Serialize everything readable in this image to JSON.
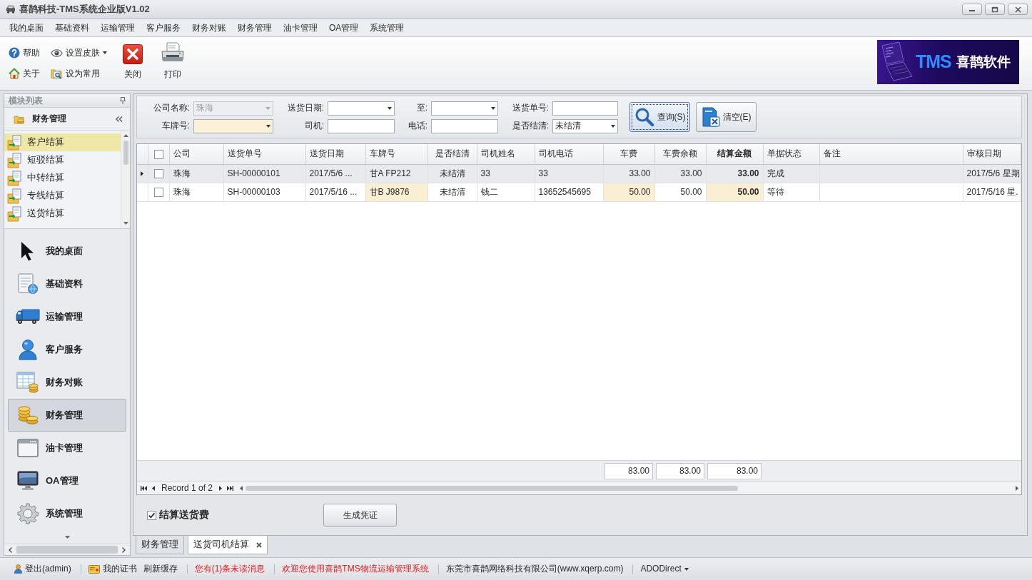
{
  "window": {
    "title": "喜鹊科技-TMS系统企业版V1.02"
  },
  "menu": [
    "我的桌面",
    "基础资料",
    "运输管理",
    "客户服务",
    "财务对账",
    "财务管理",
    "油卡管理",
    "OA管理",
    "系统管理"
  ],
  "toolbar": {
    "small_items": [
      {
        "label": "帮助",
        "dropdown": false
      },
      {
        "label": "设置皮肤",
        "dropdown": true
      },
      {
        "label": "关于",
        "dropdown": false
      },
      {
        "label": "设为常用",
        "dropdown": false
      }
    ],
    "large_items": [
      {
        "label": "关闭"
      },
      {
        "label": "打印"
      }
    ]
  },
  "logo": {
    "brand": "TMS",
    "name": "喜鹊软件"
  },
  "sidebar": {
    "title": "模块列表",
    "group": "财务管理",
    "items": [
      {
        "label": "客户结算",
        "selected": true
      },
      {
        "label": "短驳结算",
        "selected": false
      },
      {
        "label": "中转结算",
        "selected": false
      },
      {
        "label": "专线结算",
        "selected": false
      },
      {
        "label": "送货结算",
        "selected": false
      }
    ],
    "nav": [
      {
        "label": "我的桌面",
        "selected": false
      },
      {
        "label": "基础资料",
        "selected": false
      },
      {
        "label": "运输管理",
        "selected": false
      },
      {
        "label": "客户服务",
        "selected": false
      },
      {
        "label": "财务对账",
        "selected": false
      },
      {
        "label": "财务管理",
        "selected": true
      },
      {
        "label": "油卡管理",
        "selected": false
      },
      {
        "label": "OA管理",
        "selected": false
      },
      {
        "label": "系统管理",
        "selected": false
      }
    ]
  },
  "filters": [
    {
      "label": "公司名称:",
      "kind": "select",
      "value": "珠海",
      "disabled": true,
      "focused": false
    },
    {
      "label": "送货日期:",
      "kind": "select",
      "disabled": false,
      "focused": false
    },
    {
      "label": "至:",
      "kind": "select",
      "disabled": false,
      "focused": false
    },
    {
      "label": "送货单号:",
      "kind": "input",
      "disabled": false,
      "focused": false
    },
    {
      "label": "车牌号:",
      "kind": "select",
      "disabled": false,
      "focused": true
    },
    {
      "label": "司机:",
      "kind": "input",
      "disabled": false,
      "focused": false
    },
    {
      "label": "电话:",
      "kind": "input",
      "disabled": false,
      "focused": false
    },
    {
      "label": "是否结清:",
      "kind": "select",
      "value": "未结清",
      "disabled": false,
      "focused": false
    }
  ],
  "filter_buttons": [
    {
      "label": "查询(S)",
      "focused": true
    },
    {
      "label": "清空(E)",
      "focused": false
    }
  ],
  "table": {
    "header_checked": false,
    "columns": [
      {
        "label": "公司",
        "kind": "text",
        "highlighted": false,
        "emphasis": false
      },
      {
        "label": "送货单号",
        "kind": "text",
        "highlighted": false,
        "emphasis": false
      },
      {
        "label": "送货日期",
        "kind": "text",
        "highlighted": false,
        "emphasis": false
      },
      {
        "label": "车牌号",
        "kind": "text",
        "highlighted": true,
        "emphasis": false
      },
      {
        "label": "是否结清",
        "kind": "flag",
        "highlighted": false,
        "emphasis": false
      },
      {
        "label": "司机姓名",
        "kind": "text",
        "highlighted": false,
        "emphasis": false
      },
      {
        "label": "司机电话",
        "kind": "text",
        "highlighted": false,
        "emphasis": false
      },
      {
        "label": "车费",
        "kind": "number",
        "highlighted": true,
        "emphasis": false,
        "total": "83.00"
      },
      {
        "label": "车费余额",
        "kind": "number",
        "highlighted": false,
        "emphasis": false,
        "total": "83.00"
      },
      {
        "label": "结算金额",
        "kind": "number",
        "highlighted": true,
        "emphasis": true,
        "total": "83.00"
      },
      {
        "label": "单据状态",
        "kind": "text",
        "highlighted": false,
        "emphasis": false
      },
      {
        "label": "备注",
        "kind": "text",
        "highlighted": false,
        "emphasis": false
      },
      {
        "label": "审核日期",
        "kind": "text",
        "highlighted": false,
        "emphasis": false
      }
    ],
    "rows": [
      {
        "selected": true,
        "checked": false,
        "cells": [
          "珠海",
          "SH-00000101",
          "2017/5/6 ...",
          "甘A FP212",
          "未结清",
          "33",
          "33",
          "33.00",
          "33.00",
          "33.00",
          "完成",
          null,
          "2017/5/6 星期"
        ]
      },
      {
        "selected": false,
        "checked": false,
        "cells": [
          "珠海",
          "SH-00000103",
          "2017/5/16 ...",
          "甘B J9876",
          "未结清",
          "钱二",
          "13652545695",
          "50.00",
          "50.00",
          "50.00",
          "等待",
          null,
          "2017/5/16 星."
        ]
      }
    ],
    "pager": "Record 1 of 2"
  },
  "footer": {
    "checkbox": {
      "label": "结算送货费",
      "checked": true
    },
    "button": "生成凭证"
  },
  "tabs": [
    {
      "label": "财务管理",
      "selected": false,
      "closable": false
    },
    {
      "label": "送货司机结算",
      "selected": true,
      "closable": true
    }
  ],
  "status_bar": {
    "groups": [
      {
        "items": [
          {
            "label": "登出(admin)",
            "alert": false,
            "dropdown": false
          }
        ]
      },
      {
        "items": [
          {
            "label": "我的证书",
            "alert": false,
            "dropdown": false
          },
          {
            "label": "刷新缓存",
            "alert": false,
            "dropdown": false
          }
        ]
      },
      {
        "items": [
          {
            "label": "您有(1)条未读消息",
            "alert": true,
            "dropdown": false
          }
        ]
      },
      {
        "items": [
          {
            "label": "欢迎您使用喜鹊TMS物流运输管理系统",
            "alert": true,
            "dropdown": false
          }
        ]
      },
      {
        "items": [
          {
            "label": "东莞市喜鹊网络科技有限公司(www.xqerp.com)",
            "alert": false,
            "dropdown": false
          }
        ]
      },
      {
        "items": [
          {
            "label": "ADODirect",
            "alert": false,
            "dropdown": true
          }
        ]
      }
    ]
  }
}
